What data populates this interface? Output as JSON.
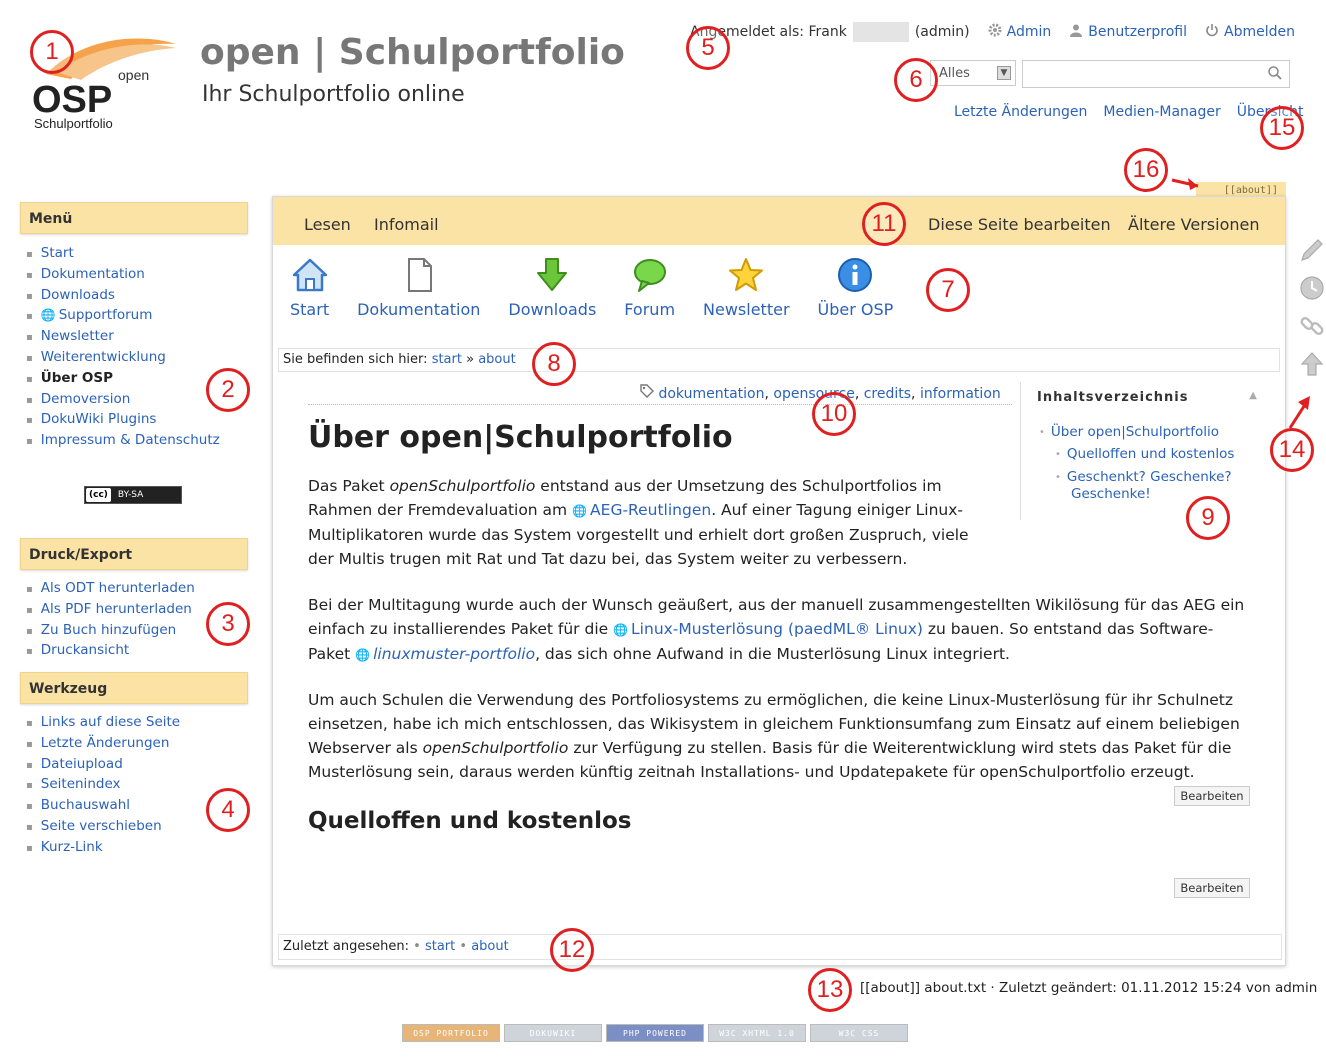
{
  "header": {
    "logo_top": "open",
    "logo_main": "OSP",
    "logo_bottom": "Schulportfolio",
    "title": "open | Schulportfolio",
    "subtitle": "Ihr Schulportfolio online"
  },
  "userbar": {
    "logged_in_label": "Angemeldet als: Frank",
    "role": "(admin)",
    "admin": "Admin",
    "profile": "Benutzerprofil",
    "logout": "Abmelden"
  },
  "search": {
    "scope": "Alles",
    "value": ""
  },
  "toplinks": [
    "Letzte Änderungen",
    "Medien-Manager",
    "Übersicht"
  ],
  "sidebar": {
    "menu_title": "Menü",
    "menu_items": [
      "Start",
      "Dokumentation",
      "Downloads",
      "Supportforum",
      "Newsletter",
      "Weiterentwicklung",
      "Über OSP",
      "Demoversion",
      "DokuWiki Plugins",
      "Impressum & Datenschutz"
    ],
    "license_a": "(cc)",
    "license_b": "BY-SA",
    "export_title": "Druck/Export",
    "export_items": [
      "Als ODT herunterladen",
      "Als PDF herunterladen",
      "Zu Buch hinzufügen",
      "Druckansicht"
    ],
    "tools_title": "Werkzeug",
    "tools_items": [
      "Links auf diese Seite",
      "Letzte Änderungen",
      "Dateiupload",
      "Seitenindex",
      "Buchauswahl",
      "Seite verschieben",
      "Kurz-Link"
    ]
  },
  "page": {
    "pageid": "[[about]]",
    "tabs": {
      "read": "Lesen",
      "infomail": "Infomail",
      "edit": "Diese Seite bearbeiten",
      "revisions": "Ältere Versionen"
    },
    "nav": [
      "Start",
      "Dokumentation",
      "Downloads",
      "Forum",
      "Newsletter",
      "Über OSP"
    ],
    "breadcrumb": {
      "label": "Sie befinden sich hier:",
      "items": [
        "start",
        "about"
      ],
      "sep": "»"
    },
    "tags": [
      "dokumentation",
      "opensource",
      "credits",
      "information"
    ],
    "toc": {
      "title": "Inhaltsverzeichnis",
      "items": [
        "Über open|Schulportfolio",
        "Quelloffen und kostenlos",
        "Geschenkt? Geschenke?",
        "Geschenke!"
      ]
    },
    "heading1": "Über open|Schulportfolio",
    "p1": {
      "a": "Das Paket ",
      "b": "openSchulportfolio",
      "c": " entstand aus der Umsetzung des Schulportfolios im Rahmen der Fremdevaluation am ",
      "link": "AEG-Reutlingen",
      "d": ". Auf einer Tagung einiger Linux-Multiplikatoren wurde das System vorgestellt und erhielt dort großen Zuspruch, viele der Multis trugen mit Rat und Tat dazu bei, das System weiter zu verbessern."
    },
    "p2": {
      "a": "Bei der Multitagung wurde auch der Wunsch geäußert, aus der manuell zusammengestellten Wikilösung für das AEG ein einfach zu installierendes Paket für die ",
      "link1": "Linux-Musterlösung (paedML® Linux)",
      "b": " zu bauen. So entstand das Software-Paket ",
      "link2": "linuxmuster-portfolio",
      "c": ", das sich ohne Aufwand in die Musterlösung Linux integriert."
    },
    "p3": {
      "a": "Um auch Schulen die Verwendung des Portfoliosystems zu ermöglichen, die keine Linux-Musterlösung für ihr Schulnetz einsetzen, habe ich mich entschlossen, das Wikisystem in gleichem Funktionsumfang zum Einsatz auf einem beliebigen Webserver als ",
      "b": "openSchulportfolio",
      "c": " zur Verfügung zu stellen. Basis für die Weiterentwicklung wird stets das Paket für die Musterlösung sein, daraus werden künftig zeitnah Installations- und Updatepakete für openSchulportfolio erzeugt."
    },
    "edit_button": "Bearbeiten",
    "heading2": "Quelloffen und kostenlos",
    "trace": {
      "label": "Zuletzt angesehen:",
      "items": [
        "start",
        "about"
      ]
    }
  },
  "footer": {
    "info": "[[about]] about.txt · Zuletzt geändert: 01.11.2012 15:24 von admin",
    "badges": [
      "OSP PORTFOLIO",
      "DOKUWIKI",
      "PHP POWERED",
      "W3C XHTML 1.0",
      "W3C CSS"
    ]
  },
  "annotations": [
    "1",
    "2",
    "3",
    "4",
    "5",
    "6",
    "7",
    "8",
    "9",
    "10",
    "11",
    "12",
    "13",
    "14",
    "15",
    "16"
  ],
  "colors": {
    "accent_bar": "#fbe3a6",
    "link": "#2b62b8",
    "annotation": "#e02020"
  }
}
